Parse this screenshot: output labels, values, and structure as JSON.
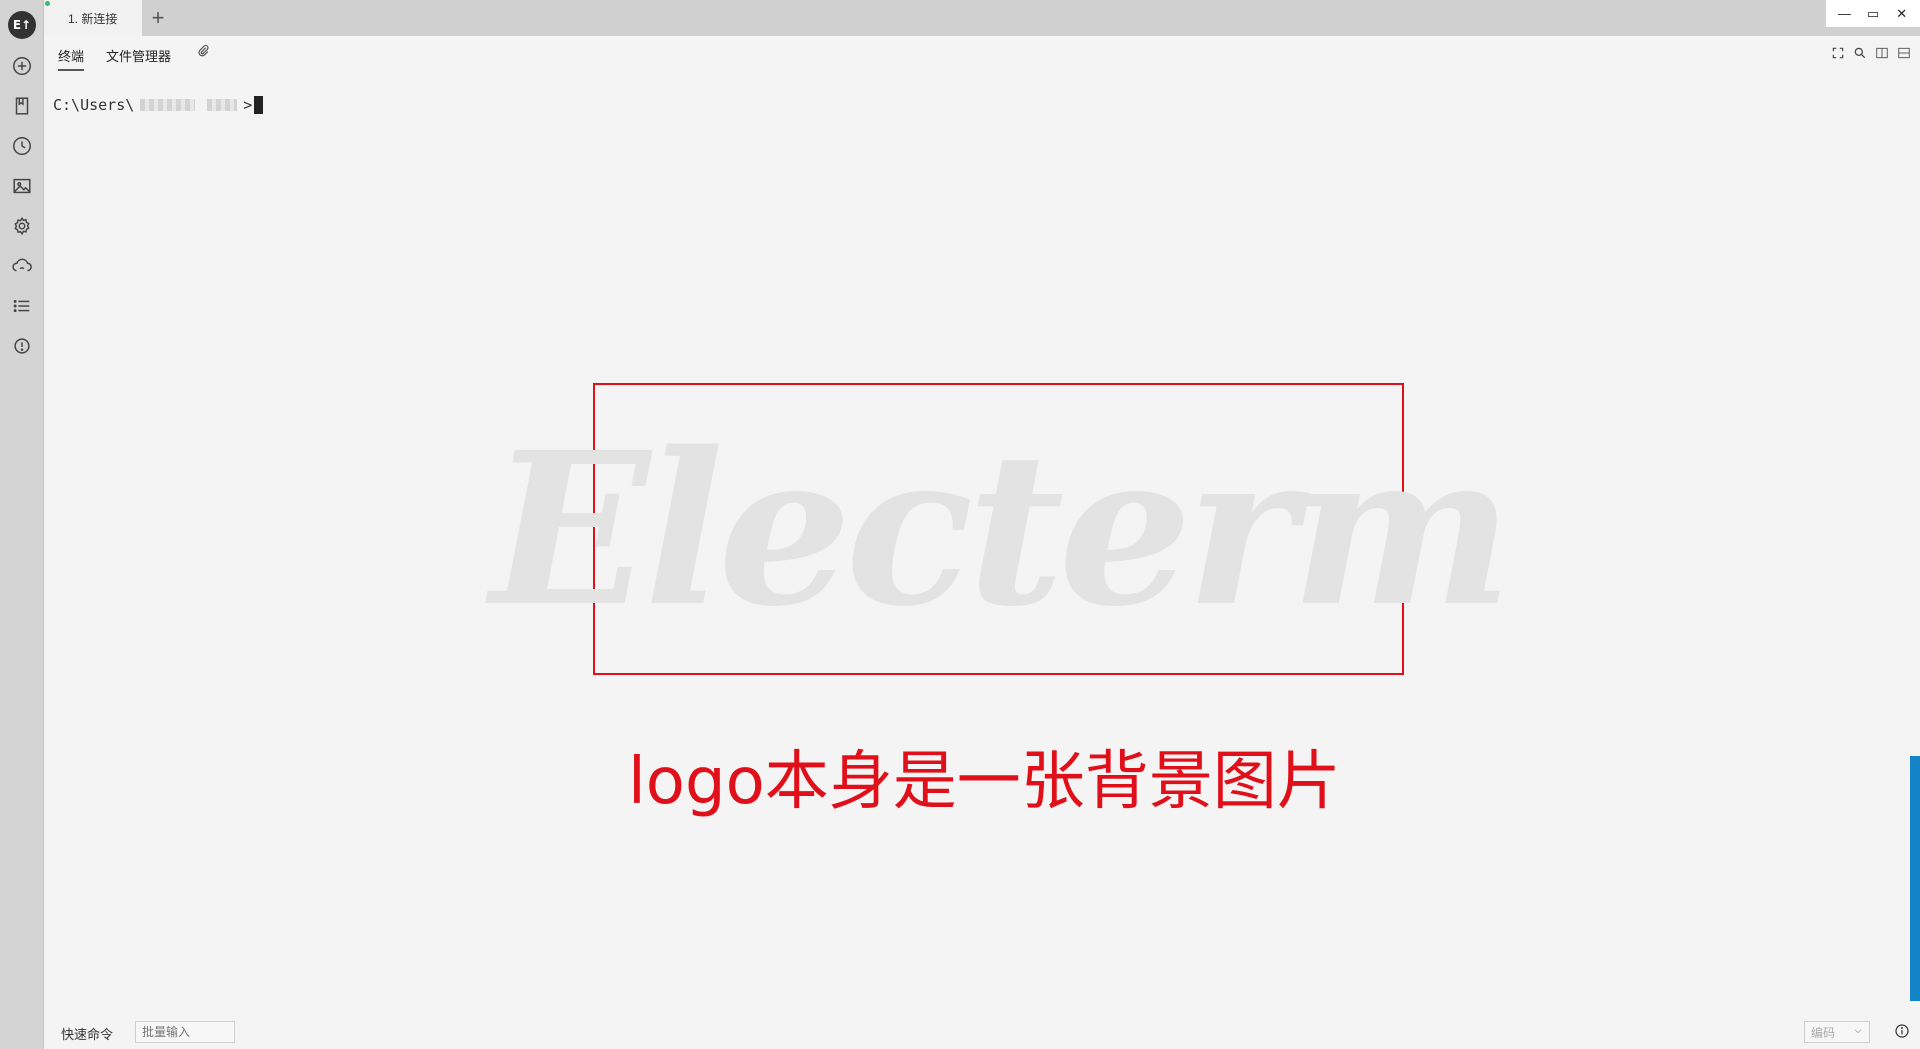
{
  "tabs": {
    "items": [
      {
        "label": "1. 新连接",
        "status_color": "#2fbf71"
      }
    ],
    "add_label": "+"
  },
  "window_controls": {
    "minimize": "—",
    "restore": "▭",
    "close": "✕"
  },
  "subtabs": {
    "terminal": "终端",
    "file_manager": "文件管理器"
  },
  "terminal": {
    "prompt_prefix": "C:\\Users\\",
    "prompt_suffix": ">"
  },
  "logo": {
    "text": "Electerm"
  },
  "annotation": {
    "text": "logo本身是一张背景图片",
    "color": "#e0101a"
  },
  "bottom": {
    "quick_command_label": "快速命令",
    "batch_input_placeholder": "批量输入",
    "encoding_label": "编码"
  },
  "sidebar": {
    "icons": [
      "electerm-logo-icon",
      "add-circle-icon",
      "bookmark-icon",
      "history-clock-icon",
      "image-icon",
      "gear-icon",
      "cloud-sync-icon",
      "list-icon",
      "info-icon"
    ]
  },
  "colors": {
    "accent": "#1384c8",
    "annotation_red": "#e0101a",
    "sidebar_bg": "#d4d4d4"
  }
}
